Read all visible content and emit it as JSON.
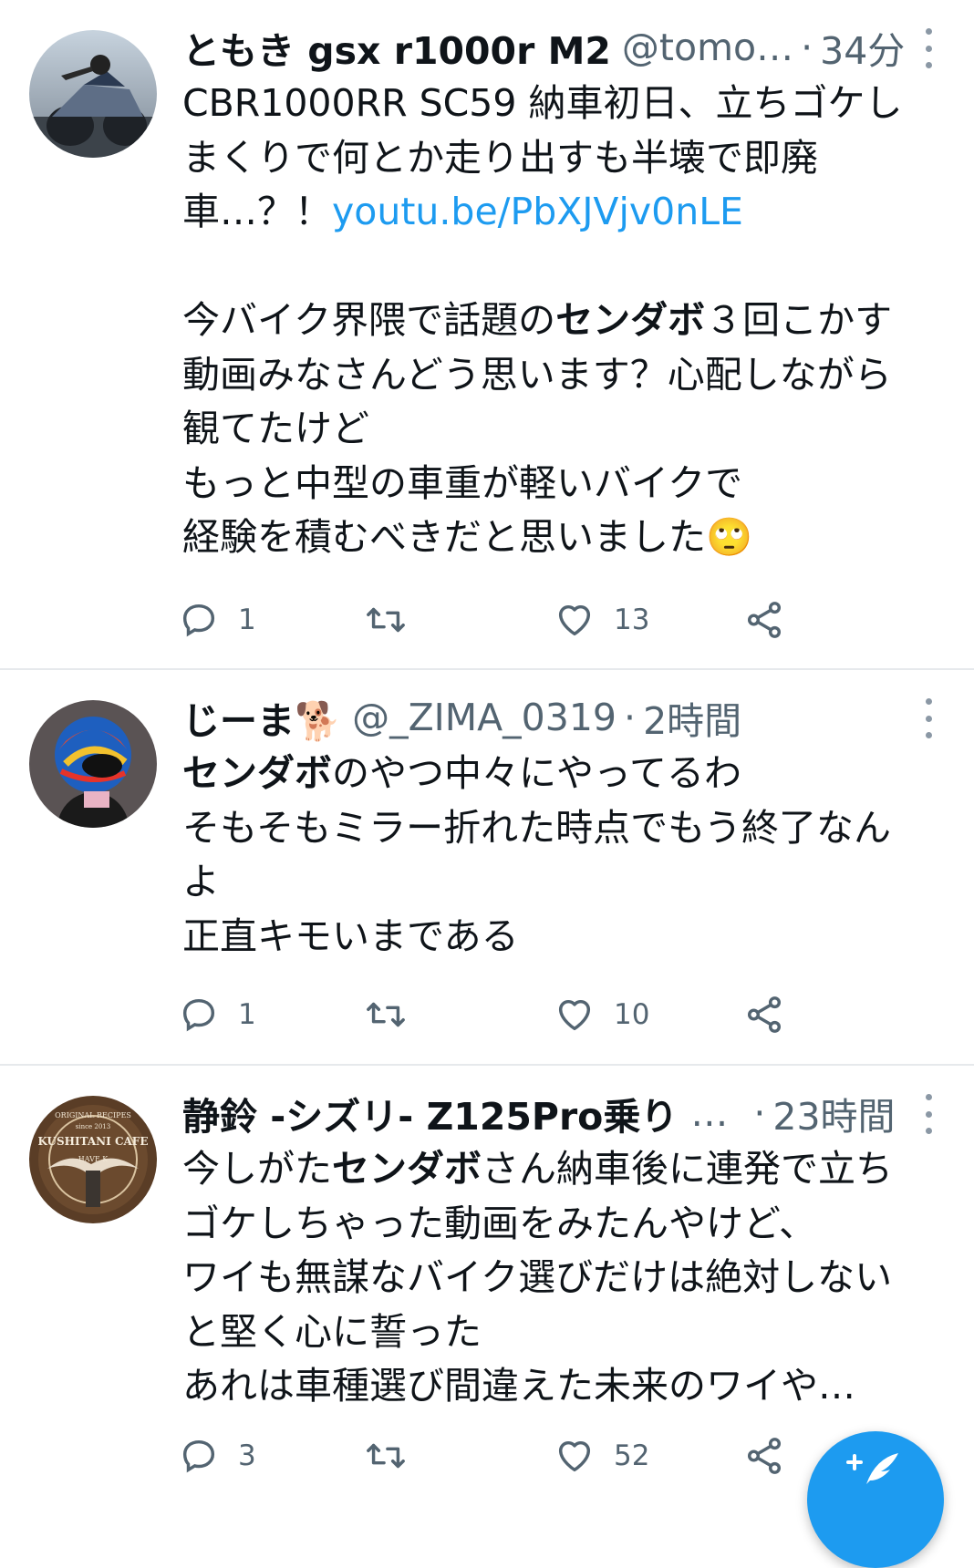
{
  "tweets": [
    {
      "name": "ともき gsx r1000r M2",
      "handle": "@tomo…",
      "time": "34分",
      "lines": [
        [
          {
            "t": "CBR1000RR SC59 納車初日、立ちゴケし"
          }
        ],
        [
          {
            "t": "まくりで何とか走り出すも半壊で即廃"
          }
        ],
        [
          {
            "t": "車…？！"
          },
          {
            "t": "youtu.be/PbXJVjv0nLE",
            "link": true
          }
        ],
        [],
        [
          {
            "t": "今バイク界隈で話題の"
          },
          {
            "t": "センダボ",
            "b": true
          },
          {
            "t": "３回こかす"
          }
        ],
        [
          {
            "t": "動画みなさんどう思います？心配しながら"
          }
        ],
        [
          {
            "t": "観てたけど"
          }
        ],
        [
          {
            "t": "もっと中型の車重が軽いバイクで"
          }
        ],
        [
          {
            "t": "経験を積むべきだと思いました"
          },
          {
            "t": "🙄"
          }
        ]
      ],
      "reply_count": "1",
      "retweet_count": "",
      "like_count": "13"
    },
    {
      "name": "じーま🐕",
      "handle": "@_ZIMA_0319",
      "time": "2時間",
      "lines": [
        [
          {
            "t": "センダボ",
            "b": true
          },
          {
            "t": "のやつ中々にやってるわ"
          }
        ],
        [
          {
            "t": "そもそもミラー折れた時点でもう終了なん"
          }
        ],
        [
          {
            "t": "よ"
          }
        ],
        [
          {
            "t": "正直キモいまである"
          }
        ]
      ],
      "reply_count": "1",
      "retweet_count": "",
      "like_count": "10"
    },
    {
      "name": "静鈴 -シズリ- Z125Pro乗り",
      "handle": "",
      "name_ellipsis": "…",
      "time": "23時間",
      "lines": [
        [
          {
            "t": "今しがた"
          },
          {
            "t": "センダボ",
            "b": true
          },
          {
            "t": "さん納車後に連発で立ち"
          }
        ],
        [
          {
            "t": "ゴケしちゃった動画をみたんやけど、"
          }
        ],
        [
          {
            "t": "ワイも無謀なバイク選びだけは絶対しない"
          }
        ],
        [
          {
            "t": "と堅く心に誓った"
          }
        ],
        [
          {
            "t": "あれは車種選び間違えた未来のワイや…"
          }
        ]
      ],
      "reply_count": "3",
      "retweet_count": "",
      "like_count": "52"
    }
  ],
  "avatar3_text": {
    "top": "ORIGINAL RECIPES",
    "since": "since 2013",
    "brand": "KUSHITANI CAFE",
    "bottom": "HAVE  K"
  },
  "colors": {
    "accent": "#1d9bf0",
    "text": "#0f1419",
    "secondary": "#536471",
    "divider": "#e6e9ec"
  },
  "icons": {
    "reply": "reply-icon",
    "retweet": "retweet-icon",
    "like": "heart-icon",
    "share": "share-icon",
    "more": "more-vertical-icon",
    "compose": "compose-tweet-icon"
  }
}
